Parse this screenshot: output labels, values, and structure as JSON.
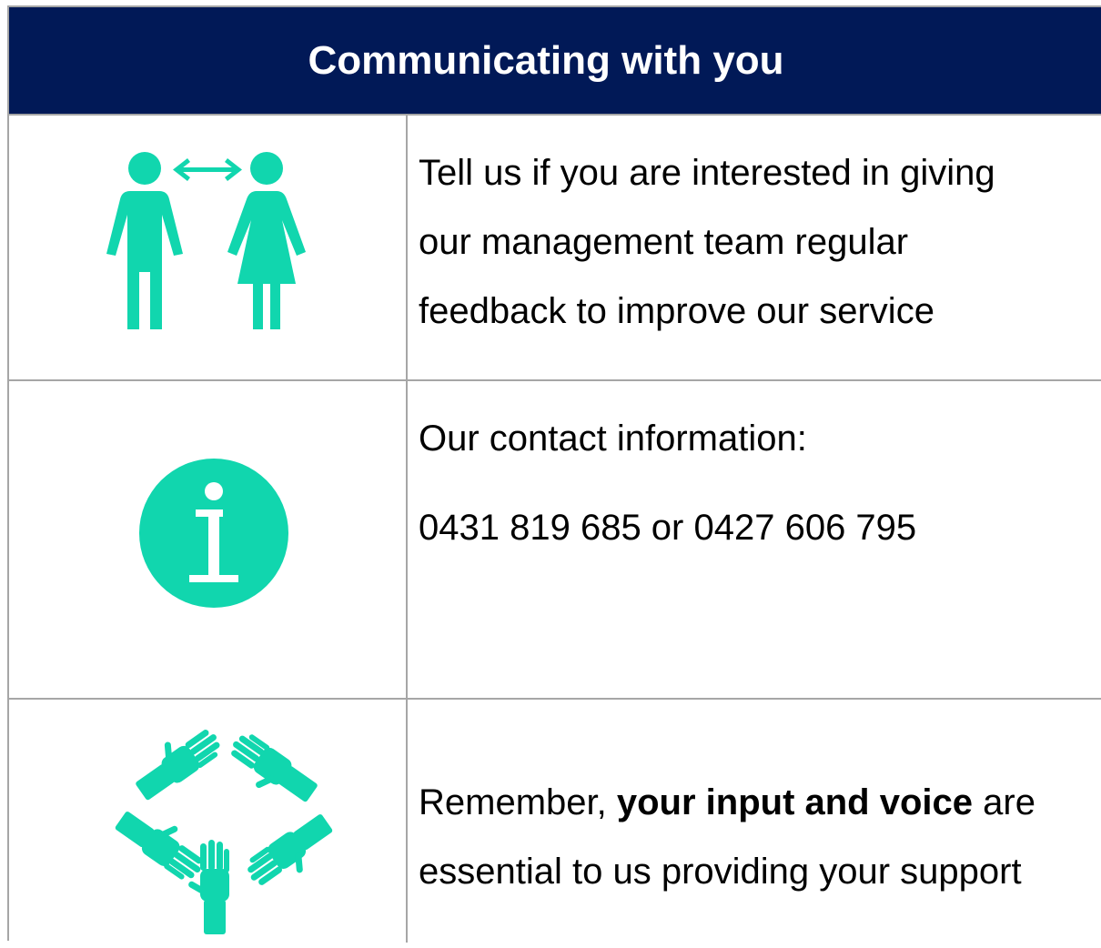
{
  "header": {
    "title": "Communicating with you",
    "background": "#011957",
    "text_color": "#ffffff"
  },
  "accent_color": "#11d6ae",
  "rows": [
    {
      "icon": "people-communicating-icon",
      "lines": [
        "Tell us if you are interested in giving",
        "our management team regular",
        "feedback to improve our service"
      ]
    },
    {
      "icon": "information-icon",
      "heading": "Our contact information:",
      "phone": "0431 819 685 or 0427 606 795"
    },
    {
      "icon": "hands-together-icon",
      "line1_prefix": "Remember, ",
      "line1_bold": "your input and voice",
      "line1_suffix": " are",
      "line2": "essential to us providing your support"
    }
  ]
}
